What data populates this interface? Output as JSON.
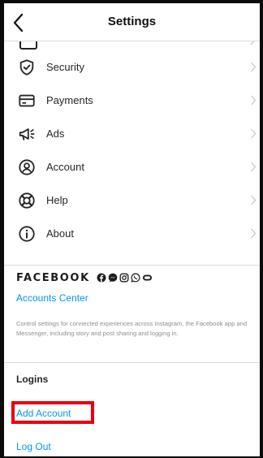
{
  "header": {
    "title": "Settings",
    "back_icon": "chevron-left-icon"
  },
  "menu": {
    "items": [
      {
        "label": "Security",
        "icon": "shield-check-icon"
      },
      {
        "label": "Payments",
        "icon": "credit-card-icon"
      },
      {
        "label": "Ads",
        "icon": "megaphone-icon"
      },
      {
        "label": "Account",
        "icon": "at-sign-icon"
      },
      {
        "label": "Help",
        "icon": "lifebuoy-icon"
      },
      {
        "label": "About",
        "icon": "info-circle-icon"
      }
    ]
  },
  "facebook": {
    "wordmark": "FACEBOOK",
    "app_icons": [
      "facebook-icon",
      "messenger-icon",
      "instagram-icon",
      "whatsapp-icon",
      "portal-icon"
    ],
    "accounts_center_label": "Accounts Center",
    "description": "Control settings for connected experiences across Instagram, the Facebook app and Messenger, including story and post sharing and logging in."
  },
  "logins": {
    "heading": "Logins",
    "add_account_label": "Add Account",
    "log_out_label": "Log Out"
  },
  "colors": {
    "link": "#0095f6",
    "highlight_border": "#e8000e",
    "divider": "#dbdbdb",
    "muted_text": "#8e8e8e"
  }
}
